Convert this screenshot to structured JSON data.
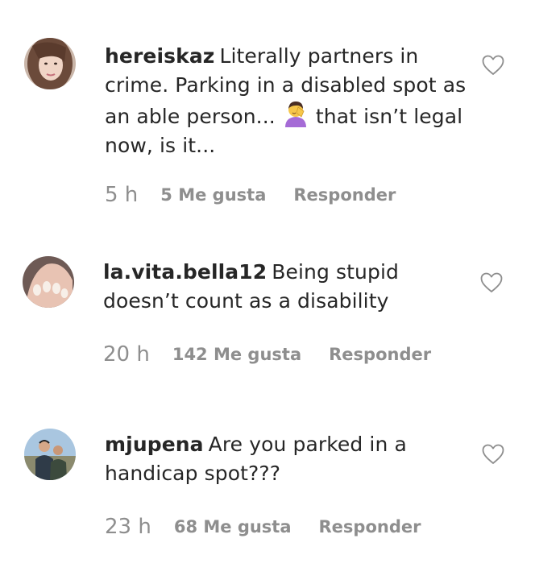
{
  "comments": [
    {
      "username": "hereiskaz",
      "text_before": "Literally partners in crime. Parking in a disabled spot as an able person...",
      "emoji": "person-facepalming-emoji",
      "text_after": "that isn’t legal now, is it...",
      "time": "5 h",
      "likes": "5 Me gusta",
      "reply": "Responder"
    },
    {
      "username": "la.vita.bella12",
      "text": "Being stupid doesn’t count as a disability",
      "time": "20 h",
      "likes": "142 Me gusta",
      "reply": "Responder"
    },
    {
      "username": "mjupena",
      "text": "Are you parked in a handicap spot???",
      "time": "23 h",
      "likes": "68 Me gusta",
      "reply": "Responder"
    }
  ],
  "colors": {
    "text": "#262626",
    "secondary": "#8e8e8e",
    "heart_stroke": "#8e8e8e"
  },
  "icons": [
    "avatar",
    "heart-outline-icon"
  ]
}
